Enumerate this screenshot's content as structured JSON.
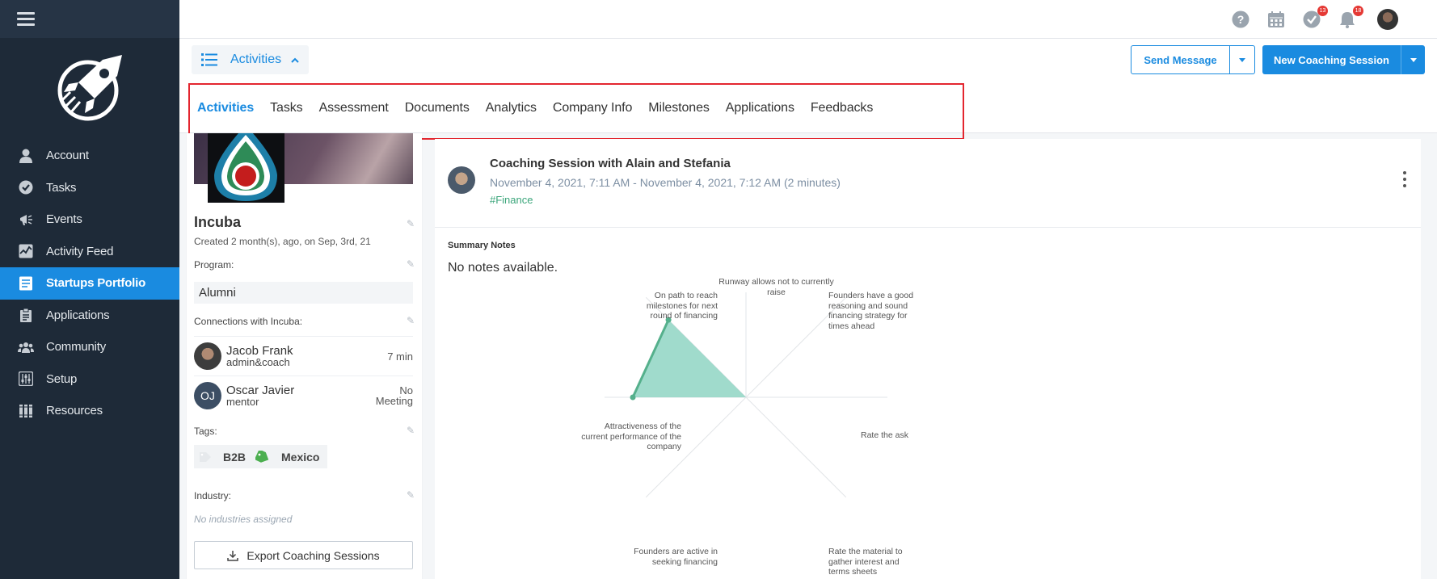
{
  "sidebar": {
    "items": [
      {
        "label": "Account",
        "icon": "person-icon",
        "active": false
      },
      {
        "label": "Tasks",
        "icon": "check-circle-icon",
        "active": false
      },
      {
        "label": "Events",
        "icon": "megaphone-icon",
        "active": false
      },
      {
        "label": "Activity Feed",
        "icon": "activity-chart-icon",
        "active": false
      },
      {
        "label": "Startups Portfolio",
        "icon": "portfolio-list-icon",
        "active": true
      },
      {
        "label": "Applications",
        "icon": "clipboard-icon",
        "active": false
      },
      {
        "label": "Community",
        "icon": "people-icon",
        "active": false
      },
      {
        "label": "Setup",
        "icon": "sliders-icon",
        "active": false
      },
      {
        "label": "Resources",
        "icon": "books-icon",
        "active": false
      }
    ]
  },
  "topbar": {
    "badges": {
      "tasks": "13",
      "notifications": "18"
    }
  },
  "header": {
    "section_toggle": "Activities",
    "send_message": "Send Message",
    "new_session": "New Coaching Session"
  },
  "tabs": [
    "Activities",
    "Tasks",
    "Assessment",
    "Documents",
    "Analytics",
    "Company Info",
    "Milestones",
    "Applications",
    "Feedbacks"
  ],
  "startup": {
    "name": "Incuba",
    "created": "Created 2 month(s), ago, on Sep, 3rd, 21",
    "program_label": "Program:",
    "program_value": "Alumni",
    "connections_label": "Connections with Incuba:",
    "connections": [
      {
        "name": "Jacob Frank",
        "role": "admin&coach",
        "right_line1": "7 min",
        "right_line2": ""
      },
      {
        "name": "Oscar Javier",
        "role": "mentor",
        "initials": "OJ",
        "right_line1": "No",
        "right_line2": "Meeting"
      }
    ],
    "tags_label": "Tags:",
    "tags": [
      "B2B",
      "Mexico"
    ],
    "industry_label": "Industry:",
    "industry_empty": "No industries assigned",
    "export_button": "Export Coaching Sessions"
  },
  "session": {
    "title": "Coaching Session with Alain and Stefania",
    "date": "November 4, 2021, 7:11 AM - November 4, 2021, 7:12 AM (2 minutes)",
    "tag": "#Finance",
    "summary_title": "Summary Notes",
    "summary_text": "No notes available."
  },
  "chart_data": {
    "type": "radar",
    "axes": [
      "Runway allows not to currently raise",
      "Founders have a good reasoning and sound financing strategy for times ahead",
      "Rate the ask",
      "Rate the material to gather interest and terms sheets",
      "Founders are active in seeking financing",
      "Attractiveness of the current performance of the company",
      "On path to reach milestones for next round of financing"
    ],
    "values": [
      0,
      0,
      0,
      0,
      0,
      3.2,
      3.1
    ],
    "max": 4,
    "fill_color": "#8fd5c3",
    "stroke_color": "#55b08c"
  },
  "colors": {
    "accent": "#1a8be0",
    "sidebar": "#1e2a38",
    "tag_green": "#3aa57a"
  }
}
